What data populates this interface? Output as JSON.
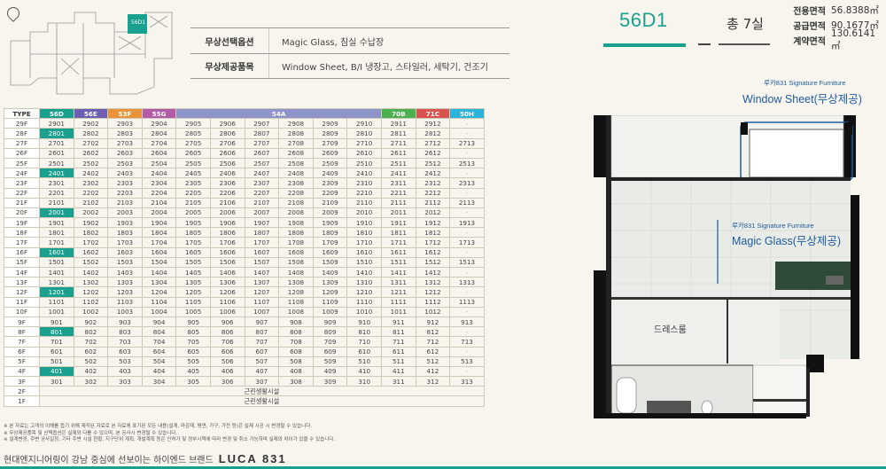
{
  "unit": {
    "type_name": "56D1",
    "rooms": "총 7실",
    "areas": [
      {
        "label": "전용면적",
        "value": "56.8388㎡"
      },
      {
        "label": "공급면적",
        "value": "90.1677㎡"
      },
      {
        "label": "계약면적",
        "value": "130.6141㎡"
      }
    ]
  },
  "sitemap": {
    "highlight_label": "56D1"
  },
  "options": [
    {
      "label": "무상선택옵션",
      "value": "Magic Glass, 침실 수납장"
    },
    {
      "label": "무상제공품목",
      "value": "Window Sheet, B/I 냉장고, 스타일러, 세탁기, 건조기"
    }
  ],
  "table": {
    "headers": [
      {
        "label": "TYPE",
        "color": "#ffffff",
        "text": "#333333",
        "span": 1
      },
      {
        "label": "56D",
        "color": "#1aa08e",
        "text": "#ffffff",
        "span": 1
      },
      {
        "label": "56E",
        "color": "#6c5fb3",
        "text": "#ffffff",
        "span": 1
      },
      {
        "label": "53F",
        "color": "#e8943a",
        "text": "#ffffff",
        "span": 1
      },
      {
        "label": "55G",
        "color": "#b45ba8",
        "text": "#ffffff",
        "span": 1
      },
      {
        "label": "54A",
        "color": "#8e93c9",
        "text": "#ffffff",
        "span": 6
      },
      {
        "label": "70B",
        "color": "#4caf50",
        "text": "#ffffff",
        "span": 1
      },
      {
        "label": "71C",
        "color": "#d9534f",
        "text": "#ffffff",
        "span": 1
      },
      {
        "label": "50H",
        "color": "#2bb3d9",
        "text": "#ffffff",
        "span": 1
      }
    ],
    "rows": [
      [
        "29F",
        "2901",
        "2902",
        "2903",
        "2904",
        "2905",
        "2906",
        "2907",
        "2908",
        "2909",
        "2910",
        "2911",
        "2912",
        "-"
      ],
      [
        "28F",
        "2801",
        "2802",
        "2803",
        "2804",
        "2805",
        "2806",
        "2807",
        "2808",
        "2809",
        "2810",
        "2811",
        "2812",
        "-"
      ],
      [
        "27F",
        "2701",
        "2702",
        "2703",
        "2704",
        "2705",
        "2706",
        "2707",
        "2708",
        "2709",
        "2710",
        "2711",
        "2712",
        "2713"
      ],
      [
        "26F",
        "2601",
        "2602",
        "2603",
        "2604",
        "2605",
        "2606",
        "2607",
        "2608",
        "2609",
        "2610",
        "2611",
        "2612",
        "-"
      ],
      [
        "25F",
        "2501",
        "2502",
        "2503",
        "2504",
        "2505",
        "2506",
        "2507",
        "2508",
        "2509",
        "2510",
        "2511",
        "2512",
        "2513"
      ],
      [
        "24F",
        "2401",
        "2402",
        "2403",
        "2404",
        "2405",
        "2406",
        "2407",
        "2408",
        "2409",
        "2410",
        "2411",
        "2412",
        "-"
      ],
      [
        "23F",
        "2301",
        "2302",
        "2303",
        "2304",
        "2305",
        "2306",
        "2307",
        "2308",
        "2309",
        "2310",
        "2311",
        "2312",
        "2313"
      ],
      [
        "22F",
        "2201",
        "2202",
        "2203",
        "2204",
        "2205",
        "2206",
        "2207",
        "2208",
        "2209",
        "2210",
        "2211",
        "2212",
        "-"
      ],
      [
        "21F",
        "2101",
        "2102",
        "2103",
        "2104",
        "2105",
        "2106",
        "2107",
        "2108",
        "2109",
        "2110",
        "2111",
        "2112",
        "2113"
      ],
      [
        "20F",
        "2001",
        "2002",
        "2003",
        "2004",
        "2005",
        "2006",
        "2007",
        "2008",
        "2009",
        "2010",
        "2011",
        "2012",
        "-"
      ],
      [
        "19F",
        "1901",
        "1902",
        "1903",
        "1904",
        "1905",
        "1906",
        "1907",
        "1908",
        "1909",
        "1910",
        "1911",
        "1912",
        "1913"
      ],
      [
        "18F",
        "1801",
        "1802",
        "1803",
        "1804",
        "1805",
        "1806",
        "1807",
        "1808",
        "1809",
        "1810",
        "1811",
        "1812",
        "-"
      ],
      [
        "17F",
        "1701",
        "1702",
        "1703",
        "1704",
        "1705",
        "1706",
        "1707",
        "1708",
        "1709",
        "1710",
        "1711",
        "1712",
        "1713"
      ],
      [
        "16F",
        "1601",
        "1602",
        "1603",
        "1604",
        "1605",
        "1606",
        "1607",
        "1608",
        "1609",
        "1610",
        "1611",
        "1612",
        "-"
      ],
      [
        "15F",
        "1501",
        "1502",
        "1503",
        "1504",
        "1505",
        "1506",
        "1507",
        "1508",
        "1509",
        "1510",
        "1511",
        "1512",
        "1513"
      ],
      [
        "14F",
        "1401",
        "1402",
        "1403",
        "1404",
        "1405",
        "1406",
        "1407",
        "1408",
        "1409",
        "1410",
        "1411",
        "1412",
        "-"
      ],
      [
        "13F",
        "1301",
        "1302",
        "1303",
        "1304",
        "1305",
        "1306",
        "1307",
        "1308",
        "1309",
        "1310",
        "1311",
        "1312",
        "1313"
      ],
      [
        "12F",
        "1201",
        "1202",
        "1203",
        "1204",
        "1205",
        "1206",
        "1207",
        "1208",
        "1209",
        "1210",
        "1211",
        "1212",
        "-"
      ],
      [
        "11F",
        "1101",
        "1102",
        "1103",
        "1104",
        "1105",
        "1106",
        "1107",
        "1108",
        "1109",
        "1110",
        "1111",
        "1112",
        "1113"
      ],
      [
        "10F",
        "1001",
        "1002",
        "1003",
        "1004",
        "1005",
        "1006",
        "1007",
        "1008",
        "1009",
        "1010",
        "1011",
        "1012",
        "-"
      ],
      [
        "9F",
        "901",
        "902",
        "903",
        "904",
        "905",
        "906",
        "907",
        "908",
        "909",
        "910",
        "911",
        "912",
        "913"
      ],
      [
        "8F",
        "801",
        "802",
        "803",
        "804",
        "805",
        "806",
        "807",
        "808",
        "809",
        "810",
        "811",
        "812",
        "-"
      ],
      [
        "7F",
        "701",
        "702",
        "703",
        "704",
        "705",
        "706",
        "707",
        "708",
        "709",
        "710",
        "711",
        "712",
        "713"
      ],
      [
        "6F",
        "601",
        "602",
        "603",
        "604",
        "605",
        "606",
        "607",
        "608",
        "609",
        "610",
        "611",
        "612",
        "-"
      ],
      [
        "5F",
        "501",
        "502",
        "503",
        "504",
        "505",
        "506",
        "507",
        "508",
        "509",
        "510",
        "511",
        "512",
        "513"
      ],
      [
        "4F",
        "401",
        "402",
        "403",
        "404",
        "405",
        "406",
        "407",
        "408",
        "409",
        "410",
        "411",
        "412",
        "-"
      ],
      [
        "3F",
        "301",
        "302",
        "303",
        "304",
        "305",
        "306",
        "307",
        "308",
        "309",
        "310",
        "311",
        "312",
        "313"
      ]
    ],
    "highlighted_units": [
      "2801",
      "2401",
      "2001",
      "1601",
      "1201",
      "801",
      "401"
    ],
    "bottom_rows": [
      {
        "floor": "2F",
        "text": "근린생활시설"
      },
      {
        "floor": "1F",
        "text": "근린생활시설"
      }
    ]
  },
  "notes": [
    "※ 본 자료는 고객의 이해를 돕기 위해 제작된 자료로 본 자료에 표기된 모든 내용(설계, 마감재, 평면, 가구, 가전 등)은 실제 시공 시 변경될 수 있습니다.",
    "※ 무상제공품목 및 선택옵션은 실제와 다를 수 있으며, 본 공사시 변경될 수 있습니다.",
    "※ 설계변경, 주변 공사일정, 기타 주변 시설 현황, 지구단위 계획, 개발계획 등은 인허가 및 정부시책에 따라 변경 및 취소 가능하며 실제와 차이가 있을 수 있습니다."
  ],
  "footer": {
    "tagline": "현대엔지니어링이 강남 중심에 선보이는 하이엔드 브랜드",
    "brand": "LUCA 831"
  },
  "plan": {
    "callout_top_small": "루카831 Signature Furniture",
    "callout_top_big": "Window Sheet(무상제공)",
    "callout_mid_small": "루카831 Signature Furniture",
    "callout_mid_big": "Magic Glass(무상제공)",
    "room_label": "드레스룸"
  },
  "colors": {
    "accent": "#1aa08e",
    "callout": "#1f5b9e",
    "background": "#f7f5ee"
  }
}
